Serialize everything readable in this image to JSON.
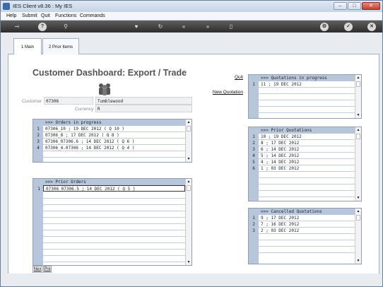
{
  "window": {
    "title": "IES Client v8.36 : My IES"
  },
  "menu": [
    "Help",
    "Submit",
    "Quit",
    "Functions",
    "Commands"
  ],
  "toolbar_icons": [
    "key-icon",
    "info-icon",
    "search-icon",
    "heart-icon",
    "refresh-icon",
    "back-icon",
    "forward-icon",
    "page-icon",
    "settings-icon",
    "check-icon",
    "close-icon"
  ],
  "tabs": [
    {
      "label": "1 Main"
    },
    {
      "label": "2 Prior Items"
    }
  ],
  "page": {
    "title": "Customer Dashboard: Export / Trade"
  },
  "customer": {
    "label": "Customer",
    "code": "07306",
    "name": "Tumblewood",
    "currency_label": "Currency",
    "currency": "R"
  },
  "links": {
    "quit": "Quit",
    "new_quotation": "New Quotation"
  },
  "orders_in_progress": {
    "header": ">>> Orders in progress",
    "rows": [
      {
        "num": "1",
        "text": "07306_10 ; 19 DEC 2012 ( Q 10 )"
      },
      {
        "num": "2",
        "text": "07306_8 ; 17 DEC 2012 ( Q 8 )"
      },
      {
        "num": "3",
        "text": "07306_07306.6 ; 14 DEC 2012 ( Q 6 )"
      },
      {
        "num": "4",
        "text": "07306_4.07306 ; 14 DEC 2012 ( Q 4 )"
      }
    ]
  },
  "prior_orders": {
    "header": ">>> Prior Orders",
    "rows": [
      {
        "num": "1",
        "text": "07306_07306.5 ; 14 DEC 2012 ( Q 5 )"
      }
    ]
  },
  "quotations_in_progress": {
    "header": ">>> Quotations in progress",
    "rows": [
      {
        "num": "1",
        "text": "11 ; 19 DEC 2012"
      }
    ]
  },
  "prior_quotations": {
    "header": ">>> Prior Quotations",
    "rows": [
      {
        "num": "1",
        "text": "10 ; 19 DEC 2012"
      },
      {
        "num": "2",
        "text": "8 ; 17 DEC 2012"
      },
      {
        "num": "3",
        "text": "6 ; 14 DEC 2012"
      },
      {
        "num": "4",
        "text": "5 ; 14 DEC 2012"
      },
      {
        "num": "5",
        "text": "4 ; 14 DEC 2012"
      },
      {
        "num": "6",
        "text": "1 ; 03 DEC 2012"
      }
    ]
  },
  "cancelled_quotations": {
    "header": ">>> Cancelled Quotations",
    "rows": [
      {
        "num": "1",
        "text": "9 ; 17 DEC 2012"
      },
      {
        "num": "2",
        "text": "7 ; 16 DEC 2012"
      },
      {
        "num": "3",
        "text": "2 ; 03 DEC 2012"
      }
    ]
  },
  "nav_buttons": {
    "next": "Nex",
    "prev": "Pre"
  },
  "colors": {
    "header_band": "#b8c6dc",
    "toolbar": "#3a3a3a",
    "title_text": "#555555"
  }
}
